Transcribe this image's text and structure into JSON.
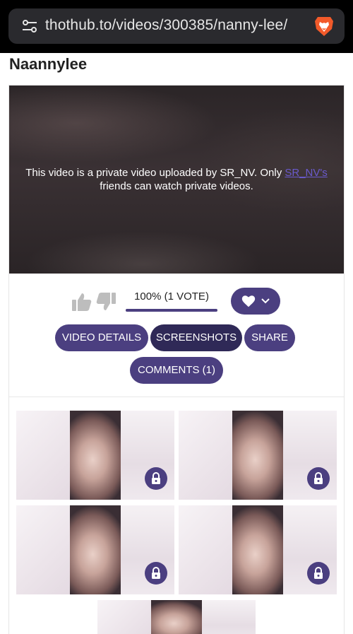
{
  "browser": {
    "url": "thothub.to/videos/300385/nanny-lee/",
    "icons": {
      "site_settings": "tune-icon",
      "brave": "brave-lion-icon"
    }
  },
  "page": {
    "title": "Naannylee"
  },
  "player": {
    "message_prefix": "This video is a private video uploaded by SR_NV. Only ",
    "message_link": "SR_NV's",
    "message_suffix": " friends can watch private videos."
  },
  "rating": {
    "text": "100% (1 VOTE)",
    "fill_percent": 100
  },
  "tabs": {
    "details": "VIDEO DETAILS",
    "screenshots": "SCREENSHOTS",
    "share": "SHARE",
    "comments": "COMMENTS (1)",
    "active": "screenshots"
  },
  "colors": {
    "accent": "#4b3f80",
    "accent_active": "#2f2957",
    "link": "#6a5acd"
  },
  "screenshots": {
    "locked": true,
    "count_visible": 5
  }
}
